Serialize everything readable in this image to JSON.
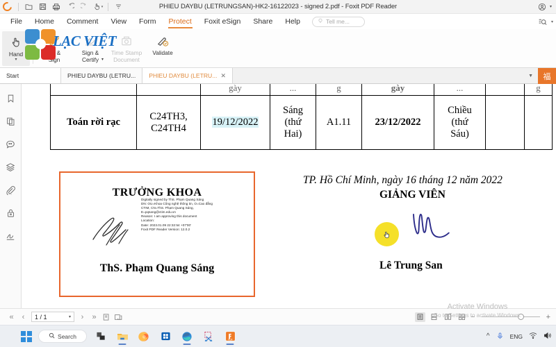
{
  "window": {
    "title": "PHIEU DAYBU (LETRUNGSAN)-HK2-16122023 - signed 2.pdf - Foxit PDF Reader",
    "quick_access": [
      "app-logo",
      "open-icon",
      "save-icon",
      "print-icon",
      "undo-icon",
      "redo-icon",
      "touch-mode-icon",
      "customize-icon"
    ],
    "account_icon": "account-icon"
  },
  "menu": {
    "items": [
      {
        "label": "File",
        "active": false
      },
      {
        "label": "Home",
        "active": false
      },
      {
        "label": "Comment",
        "active": false
      },
      {
        "label": "View",
        "active": false
      },
      {
        "label": "Form",
        "active": false
      },
      {
        "label": "Protect",
        "active": true
      },
      {
        "label": "Foxit eSign",
        "active": false
      },
      {
        "label": "Share",
        "active": false
      },
      {
        "label": "Help",
        "active": false
      }
    ],
    "tellme_placeholder": "Tell me..."
  },
  "ribbon": {
    "hand_label": "Hand",
    "buttons": [
      {
        "label": "Fill &\nSign",
        "icon": "fill-sign-icon",
        "dim": false
      },
      {
        "label": "Sign &\nCertify",
        "icon": "sign-certify-icon",
        "dim": false,
        "caret": true
      },
      {
        "label": "Time Stamp\nDocument",
        "icon": "time-stamp-icon",
        "dim": true
      },
      {
        "label": "Validate",
        "icon": "validate-icon",
        "dim": false
      }
    ],
    "overlay_logo_text": "LẠC VIỆT"
  },
  "tabs": {
    "start_label": "Start",
    "items": [
      {
        "label": "PHIEU DAYBU (LETRU...",
        "active": false,
        "closable": false
      },
      {
        "label": "PHIEU DAYBU (LETRU...",
        "active": true,
        "closable": true,
        "close_label": "✕"
      }
    ],
    "overflow_icon": "chevron-down-icon",
    "extension_button": "福"
  },
  "left_nav": {
    "items": [
      {
        "name": "bookmark-icon"
      },
      {
        "name": "page-thumbnails-icon"
      },
      {
        "name": "comments-icon"
      },
      {
        "name": "layers-icon"
      },
      {
        "name": "attachments-icon"
      },
      {
        "name": "security-lock-icon"
      },
      {
        "name": "digital-signatures-icon"
      }
    ],
    "expand_handle": "▶"
  },
  "document": {
    "table": {
      "clipped_row": [
        "",
        "",
        "gày",
        "...",
        "g",
        "gày",
        "...",
        "",
        "g"
      ],
      "row": {
        "subject": "Toán rời rạc",
        "classes": "C24TH3,\nC24TH4",
        "date1": "19/12/2022",
        "session1": "Sáng\n(thứ\nHai)",
        "room": "A1.11",
        "date2": "23/12/2022",
        "session2": "Chiều\n(thứ\nSáu)",
        "extra1": "",
        "extra2": ""
      },
      "highlighted_cell": "19/12/2022"
    },
    "place_date": "TP. Hồ Chí Minh, ngày 16 tháng 12 năm 2022",
    "lecturer_heading": "GIẢNG VIÊN",
    "lecturer_name": "Lê Trung San",
    "dean_box": {
      "heading": "TRƯỞNG KHOA",
      "name": "ThS. Phạm Quang Sáng",
      "border_color": "#e8662c",
      "signature_metadata": "Digitally signed by ThS. Phạm Quang Sáng\nDN: OU=Khoa Công nghệ thông tin, O=Cao đẳng CTIM, CN=ThS. Phạm Quang Sáng, E=pqsang@ctim.edu.vn\nReason: I am approving this document\nLocation:\nDate: 2023.01.09 22:32:54 +07'00'\nFoxit PDF Reader Version: 12.0.2"
    },
    "cursor_highlight_color": "#f5e029"
  },
  "status_bar": {
    "first_page_icon": "first-page-icon",
    "prev_page_icon": "previous-page-icon",
    "page_value": "1 / 1",
    "page_caret": "▾",
    "next_page_icon": "next-page-icon",
    "last_page_icon": "last-page-icon",
    "fit_page_icon": "fit-page-icon",
    "fit_width_icon": "fit-width-icon",
    "view_modes": [
      {
        "name": "single-page-view-icon",
        "selected": true
      },
      {
        "name": "continuous-view-icon",
        "selected": false
      },
      {
        "name": "facing-view-icon",
        "selected": false
      },
      {
        "name": "facing-continuous-view-icon",
        "selected": false
      }
    ],
    "zoom_out": "−",
    "zoom_in": "+"
  },
  "watermark": {
    "line1": "Activate Windows",
    "line2": "Go to Settings to activate Windows."
  },
  "taskbar": {
    "start_icon": "windows-start-icon",
    "search_label": "Search",
    "search_icon": "search-icon",
    "apps": [
      {
        "name": "task-view-icon",
        "running": false
      },
      {
        "name": "file-explorer-icon",
        "running": true
      },
      {
        "name": "firefox-icon",
        "running": false
      },
      {
        "name": "microsoft-store-icon",
        "running": false
      },
      {
        "name": "edge-icon",
        "running": true
      },
      {
        "name": "snipping-tool-icon",
        "running": false
      },
      {
        "name": "foxit-pdf-reader-icon",
        "running": true
      }
    ],
    "tray": {
      "overflow": "^",
      "mic_icon": "microphone-icon",
      "language": "ENG",
      "wifi_icon": "wifi-icon",
      "volume_icon": "volume-icon"
    }
  }
}
